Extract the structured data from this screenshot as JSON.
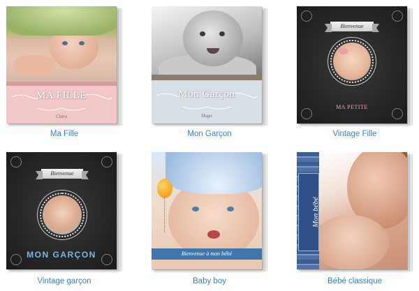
{
  "albums": [
    {
      "caption": "Ma Fille",
      "cover_title": "MA FILLE",
      "cover_name": "Clara"
    },
    {
      "caption": "Mon Garçon",
      "cover_title": "Mon Garçon",
      "cover_name": "Hugo"
    },
    {
      "caption": "Vintage Fille",
      "cover_ribbon": "Bienvenue",
      "cover_subtitle": "MA PETITE"
    },
    {
      "caption": "Vintage garçon",
      "cover_ribbon": "Bienvenue",
      "cover_subtitle": "MON GARÇON"
    },
    {
      "caption": "Baby boy",
      "cover_banner": "Bienvenue à mon bébé"
    },
    {
      "caption": "Bébé classique",
      "cover_spine_text": "Mon bébé"
    }
  ],
  "colors": {
    "caption_link": "#3a7fcc",
    "ma_fille_cover": "#f1c7c8",
    "mon_garcon_cover": "#d9dfe6",
    "chalkboard": "#262626",
    "baby_boy_banner": "#3f77ad",
    "classique_spine": "#4f72a6"
  }
}
